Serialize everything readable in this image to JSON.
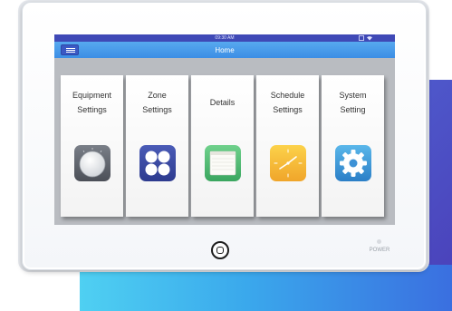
{
  "status_bar": {
    "time": "09:30 AM",
    "system_icons": "battery-icon wifi-icon"
  },
  "header": {
    "title": "Home",
    "menu_icon": "hamburger-menu-icon"
  },
  "tiles": [
    {
      "label_line1": "Equipment",
      "label_line2": "Settings",
      "icon": "dial-knob-icon"
    },
    {
      "label_line1": "Zone",
      "label_line2": "Settings",
      "icon": "four-dots-grid-icon"
    },
    {
      "label_line1": "Details",
      "label_line2": "",
      "icon": "document-window-icon"
    },
    {
      "label_line1": "Schedule",
      "label_line2": "Settings",
      "icon": "clock-icon"
    },
    {
      "label_line1": "System",
      "label_line2": "Setting",
      "icon": "gear-icon"
    }
  ],
  "device": {
    "home_button_icon": "home-button-icon",
    "power_label": "POWER"
  },
  "colors": {
    "status_bar": "#3f49b6",
    "title_bar": "#4a9be9",
    "screen_background": "#b9bcc1",
    "backdrop_blue": "#4a5fd0",
    "backdrop_cyan": "#4fd0f2"
  }
}
